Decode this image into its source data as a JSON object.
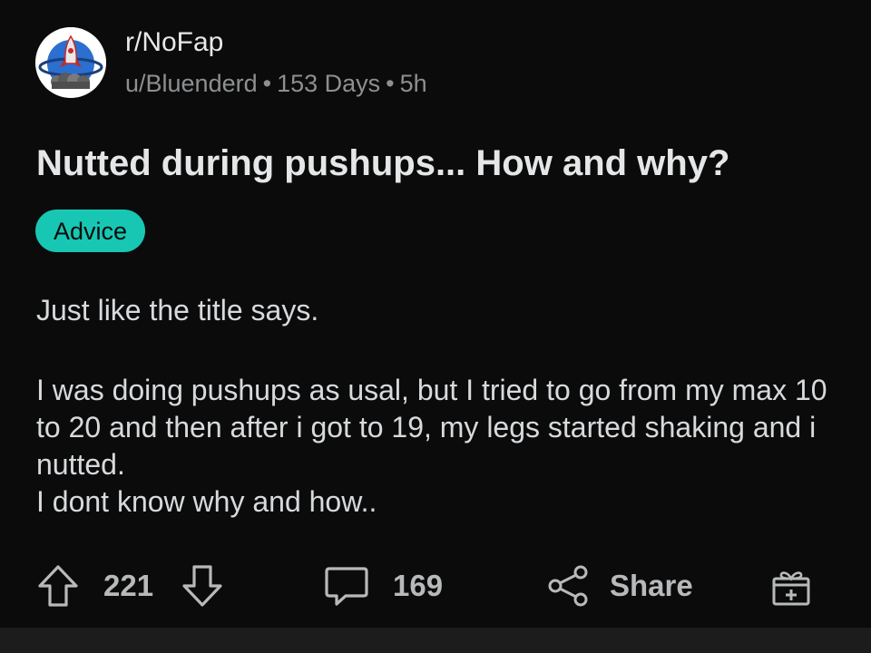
{
  "post": {
    "subreddit": "r/NoFap",
    "username": "u/Bluenderd",
    "flair_days": "153 Days",
    "age": "5h",
    "title": "Nutted during pushups... How and why?",
    "flair": "Advice",
    "body": [
      "Just like the title says.",
      "",
      "I was doing pushups as usal, but I tried to go from my max 10 to 20 and then after i got to 19, my legs started shaking and i nutted.",
      "I dont know why and how.."
    ]
  },
  "actions": {
    "upvote_icon": "arrow-up-icon",
    "score": "221",
    "downvote_icon": "arrow-down-icon",
    "comment_icon": "comment-icon",
    "comments": "169",
    "share_icon": "share-icon",
    "share_label": "Share",
    "award_icon": "gift-icon"
  },
  "colors": {
    "background": "#0b0b0b",
    "flair": "#17c7b4",
    "muted": "#8d8f91"
  }
}
